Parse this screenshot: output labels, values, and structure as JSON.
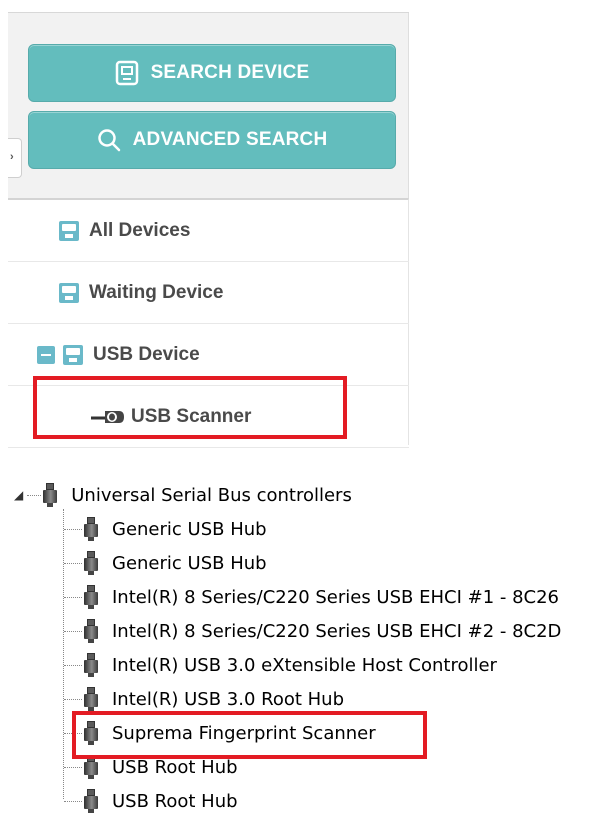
{
  "buttons": {
    "search_device": "SEARCH DEVICE",
    "advanced_search": "ADVANCED SEARCH"
  },
  "collapse_tab_glyph": "›",
  "device_list": [
    {
      "label": "All Devices",
      "icon": "device-icon"
    },
    {
      "label": "Waiting Device",
      "icon": "device-icon"
    },
    {
      "label": "USB Device",
      "icon": "device-icon",
      "expanded": true
    },
    {
      "label": "USB Scanner",
      "icon": "scanner-icon"
    }
  ],
  "tree": {
    "root_label": "Universal Serial Bus controllers",
    "expander": "◢",
    "children": [
      "Generic USB Hub",
      "Generic USB Hub",
      "Intel(R) 8 Series/C220 Series USB EHCI #1 - 8C26",
      "Intel(R) 8 Series/C220 Series USB EHCI #2 - 8C2D",
      "Intel(R) USB 3.0 eXtensible Host Controller",
      "Intel(R) USB 3.0 Root Hub",
      "Suprema Fingerprint Scanner",
      "USB Root Hub",
      "USB Root Hub"
    ]
  },
  "colors": {
    "teal_button": "#63bdbd",
    "icon_teal": "#6ab9c9",
    "highlight_red": "#e31b23"
  }
}
